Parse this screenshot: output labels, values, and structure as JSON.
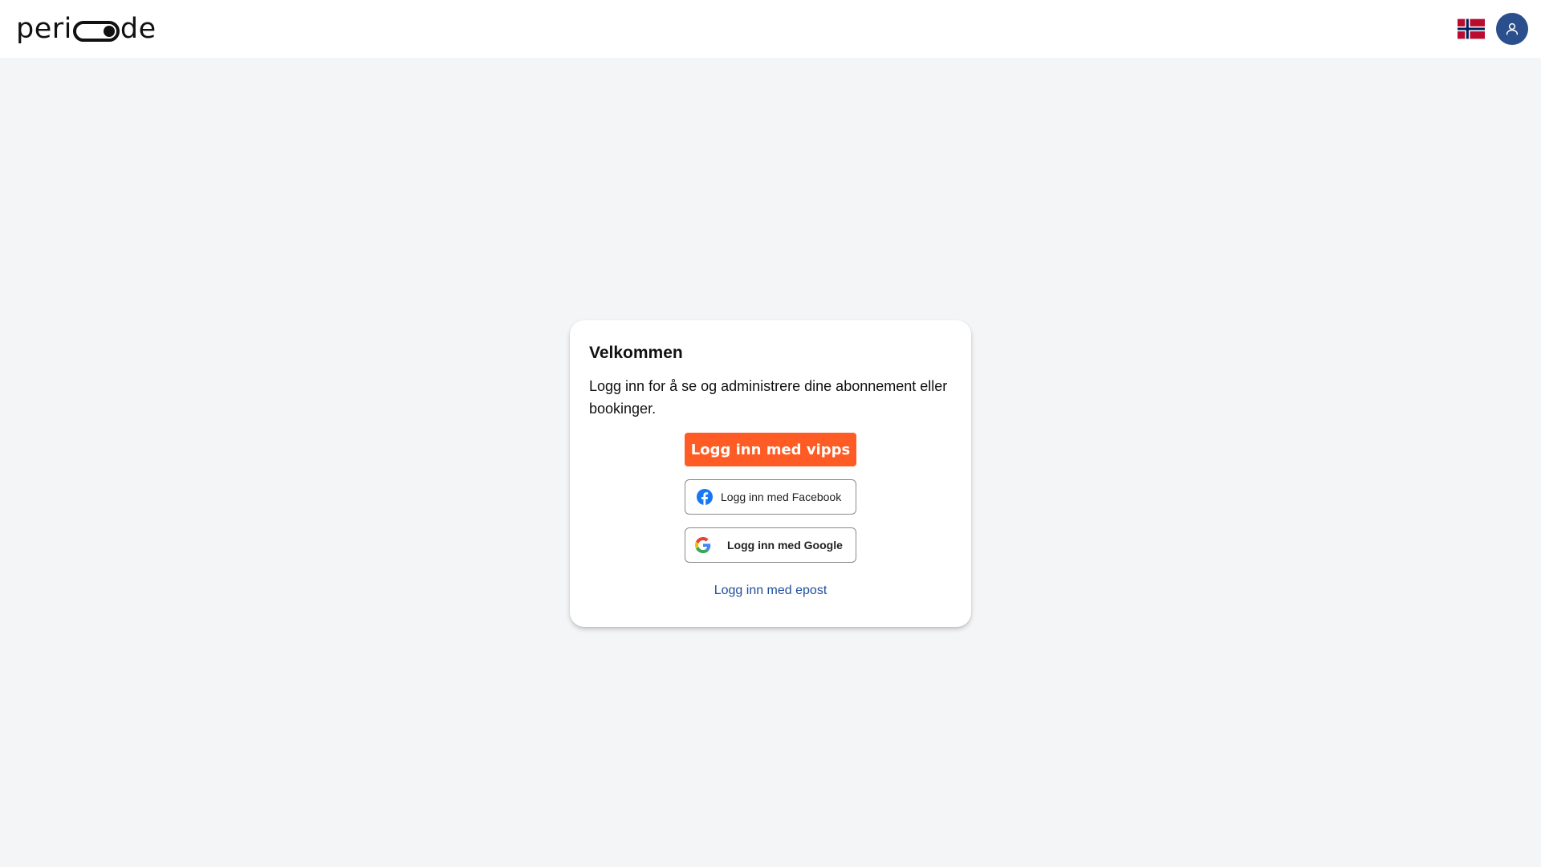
{
  "header": {
    "logo_left": "peri",
    "logo_right": "de",
    "language": "Norwegian",
    "colors": {
      "accent": "#2a4f8c"
    }
  },
  "login_card": {
    "title": "Velkommen",
    "description": "Logg inn for å se og administrere dine abonnement eller bookinger.",
    "vipps_button": "Logg inn med vipps",
    "facebook_button": "Logg inn med Facebook",
    "google_button": "Logg inn med Google",
    "email_link": "Logg inn med epost",
    "colors": {
      "vipps": "#ff5b24",
      "link": "#1f4fa0"
    }
  },
  "icons": [
    "norway-flag-icon",
    "user-icon",
    "facebook-icon",
    "google-icon"
  ]
}
